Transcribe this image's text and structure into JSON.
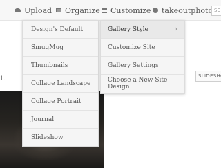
{
  "topbar": {
    "upload": "Upload",
    "organize": "Organize",
    "customize": "Customize",
    "user": "takeoutphoto",
    "search_placeholder": "SE"
  },
  "page": {
    "edge_number": "1.",
    "slideshow_label": "SLIDESHO"
  },
  "main_menu": {
    "items": [
      "Gallery Style",
      "Customize Site",
      "Gallery Settings",
      "Choose a New Site Design"
    ],
    "chevron": "›"
  },
  "gallery_style_menu": {
    "items": [
      "Design's Default",
      "SmugMug",
      "Thumbnails",
      "Collage Landscape",
      "Collage Portrait",
      "Journal",
      "Slideshow"
    ]
  }
}
